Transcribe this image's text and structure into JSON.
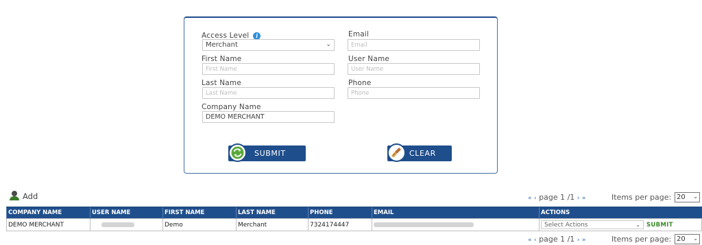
{
  "form": {
    "access_level_label": "Access Level",
    "access_level_value": "Merchant",
    "email_label": "Email",
    "email_placeholder": "Email",
    "first_name_label": "First Name",
    "first_name_placeholder": "First Name",
    "user_name_label": "User Name",
    "user_name_placeholder": "User Name",
    "last_name_label": "Last Name",
    "last_name_placeholder": "Last Name",
    "phone_label": "Phone",
    "phone_placeholder": "Phone",
    "company_name_label": "Company Name",
    "company_name_value": "DEMO MERCHANT",
    "submit_label": "SUBMIT",
    "clear_label": "CLEAR"
  },
  "toolbar": {
    "add_label": "Add",
    "pager_text": "page 1 /1",
    "items_per_page_label": "Items per page:",
    "items_per_page_value": "20"
  },
  "table": {
    "headers": [
      "COMPANY NAME",
      "USER NAME",
      "FIRST NAME",
      "LAST NAME",
      "PHONE",
      "EMAIL",
      "ACTIONS"
    ],
    "rows": [
      {
        "company_name": "DEMO MERCHANT",
        "first_name": "Demo",
        "last_name": "Merchant",
        "phone": "7324174447",
        "actions_placeholder": "Select Actions",
        "actions_submit": "SUBMIT"
      }
    ]
  },
  "colors": {
    "primary": "#1f4e8c",
    "info": "#2f8fd8",
    "action_submit": "#3a8a2a"
  },
  "icons": [
    "info-icon",
    "refresh-icon",
    "broom-icon",
    "user-add-icon",
    "chevron-down-icon",
    "first-page-icon",
    "prev-page-icon",
    "next-page-icon",
    "last-page-icon"
  ]
}
